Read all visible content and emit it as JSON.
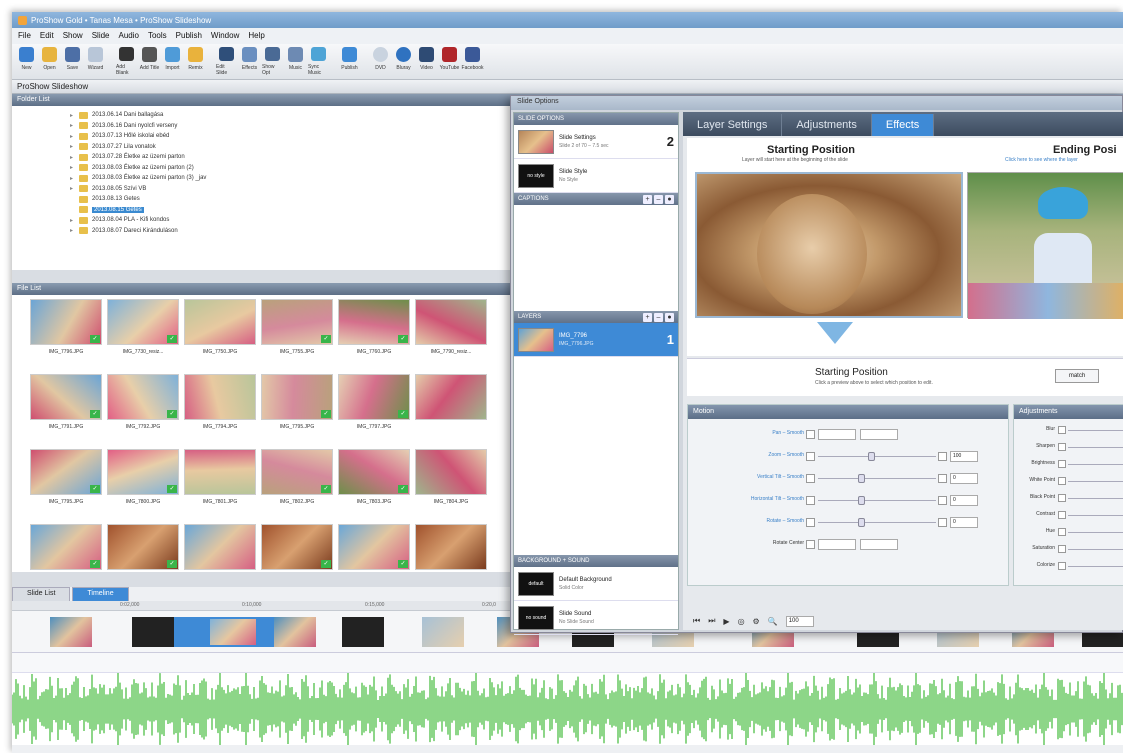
{
  "window": {
    "title": "ProShow Gold • Tanas Mesa • ProShow Slideshow"
  },
  "menu": [
    "File",
    "Edit",
    "Show",
    "Slide",
    "Audio",
    "Tools",
    "Publish",
    "Window",
    "Help"
  ],
  "toolbar": [
    "New",
    "Open",
    "Save",
    "Wizard",
    "Add Blank",
    "Add Title",
    "Import",
    "Remix",
    "Edit Slide",
    "Effects",
    "Show Opt",
    "Music",
    "Sync Music",
    "Publish",
    "DVD",
    "Bluray",
    "Video",
    "YouTube",
    "Facebook"
  ],
  "show_title": "ProShow Slideshow",
  "folder_header": "Folder List",
  "folders": [
    {
      "name": "2013.06.14 Dani ballagása",
      "selected": false
    },
    {
      "name": "2013.06.16 Dani nyolcfi verseny",
      "selected": false
    },
    {
      "name": "2013.07.13 Hőlé iskolai ebéd",
      "selected": false
    },
    {
      "name": "2013.07.27 Lila vonatok",
      "selected": false
    },
    {
      "name": "2013.07.28 Életke az üzemi parton",
      "selected": false
    },
    {
      "name": "2013.08.03 Életke az üzemi parton (2)",
      "selected": false
    },
    {
      "name": "2013.08.03 Életke az üzemi parton (3) _jav",
      "selected": false
    },
    {
      "name": "2013.08.05 Szívi VB",
      "selected": false
    },
    {
      "name": "2013.08.13 Getes",
      "selected": false
    },
    {
      "name": "2013.08.15 Getes",
      "selected": true
    },
    {
      "name": "2013.08.04 PLA - Kifi kondos",
      "selected": false
    },
    {
      "name": "2013.08.07 Dareci Kiránduláson",
      "selected": false
    }
  ],
  "file_header": "File List",
  "files": [
    "IMG_7796.JPG",
    "IMG_7730_resiz...",
    "IMG_7750.JPG",
    "IMG_7755.JPG",
    "IMG_7760.JPG",
    "IMG_7790_resiz...",
    "IMG_7791.JPG",
    "IMG_7792.JPG",
    "IMG_7794.JPG",
    "IMG_7795.JPG",
    "IMG_7797.JPG",
    "",
    "IMG_7795.JPG",
    "IMG_7800.JPG",
    "IMG_7801.JPG",
    "IMG_7802.JPG",
    "IMG_7803.JPG",
    "IMG_7804.JPG",
    "",
    "",
    "",
    "",
    "",
    ""
  ],
  "timeline": {
    "tabs": [
      "Slide List",
      "Timeline"
    ],
    "ticks": [
      "0:02,000",
      "0:10,000",
      "0:15,000",
      "0:20,0"
    ]
  },
  "dialog": {
    "title": "Slide Options",
    "slide_options_header": "SLIDE OPTIONS",
    "slide_settings": {
      "label": "Slide Settings",
      "sub": "Slide 2 of 70 – 7.5 sec",
      "num": "2"
    },
    "slide_style": {
      "label": "Slide Style",
      "sub": "No Style",
      "thumb": "no style"
    },
    "captions_header": "CAPTIONS",
    "layers_header": "LAYERS",
    "layer": {
      "label": "IMG_7796",
      "sub": "IMG_7796.JPG",
      "num": "1"
    },
    "bg_header": "BACKGROUND + SOUND",
    "bg": {
      "label": "Default Background",
      "sub": "Solid Color",
      "thumb": "default"
    },
    "sound": {
      "label": "Slide Sound",
      "sub": "No Slide Sound",
      "thumb": "no sound"
    },
    "tabs": [
      "Layer Settings",
      "Adjustments",
      "Effects"
    ],
    "active_tab": "Effects",
    "starting_title": "Starting Position",
    "starting_sub": "Layer will start here at the beginning of the slide",
    "ending_title": "Ending Posi",
    "ending_sub": "Click here to see where the layer",
    "pos_title": "Starting Position",
    "pos_sub": "Click a preview above to select which position to edit.",
    "match_label": "match",
    "motion_header": "Motion",
    "motion_rows": [
      {
        "label": "Pan – Smooth",
        "value": ""
      },
      {
        "label": "Zoom – Smooth",
        "value": "100"
      },
      {
        "label": "Vertical Tilt – Smooth",
        "value": "0"
      },
      {
        "label": "Horizontal Tilt – Smooth",
        "value": "0"
      },
      {
        "label": "Rotate – Smooth",
        "value": "0"
      },
      {
        "label": "Rotate Center",
        "value": ""
      }
    ],
    "adjust_header": "Adjustments",
    "adjust_rows": [
      "Blur",
      "Sharpen",
      "Brightness",
      "White Point",
      "Black Point",
      "Contrast",
      "Hue",
      "Saturation",
      "Colorize"
    ],
    "zoom_value": "100"
  },
  "colors": {
    "accent": "#3e8ad6",
    "wave": "#5cc455"
  }
}
